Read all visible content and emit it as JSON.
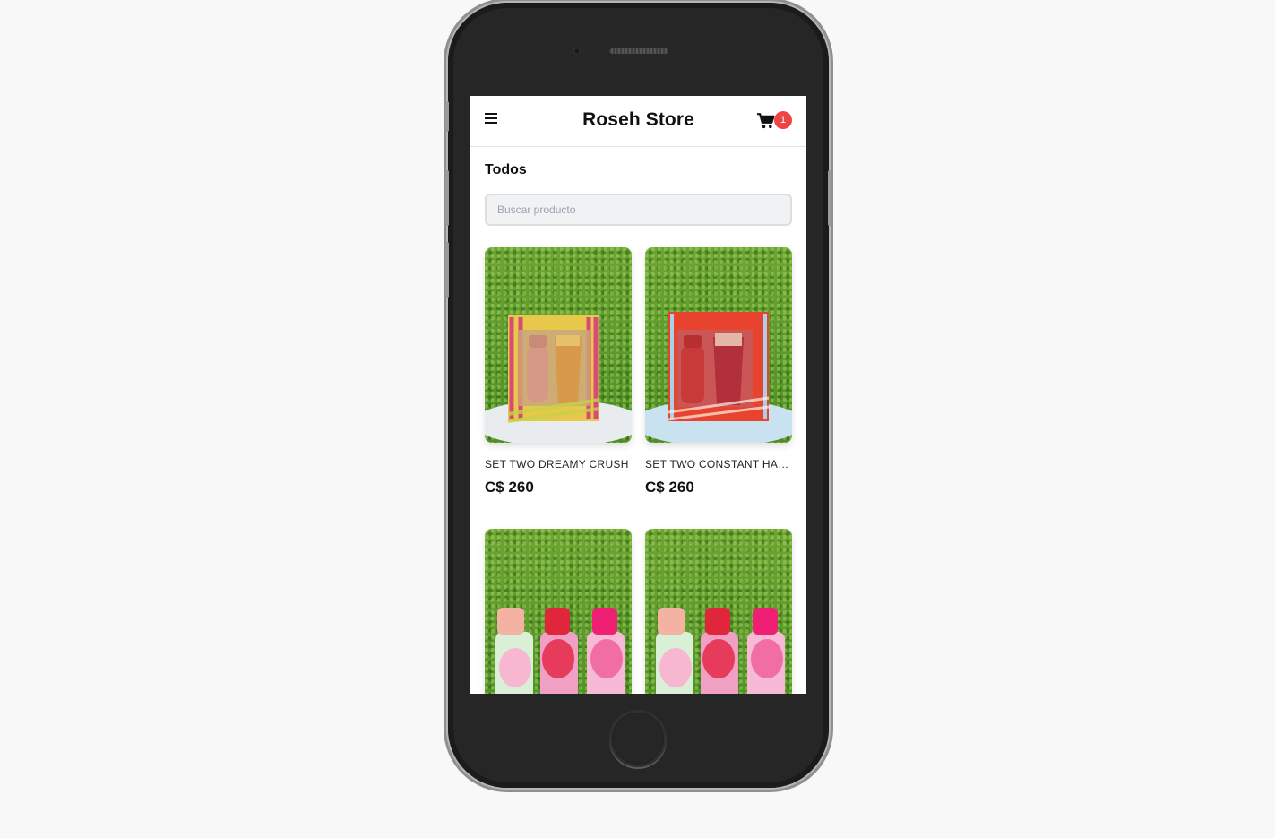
{
  "header": {
    "title": "Roseh Store",
    "cart_count": "1"
  },
  "section": {
    "title": "Todos"
  },
  "search": {
    "placeholder": "Buscar producto",
    "value": ""
  },
  "products": [
    {
      "name": "SET TWO DREAMY CRUSH",
      "price": "C$ 260",
      "image": "gift-set-yellow"
    },
    {
      "name": "SET TWO CONSTANT HAPPINESS",
      "price": "C$ 260",
      "image": "gift-set-red"
    },
    {
      "name": "",
      "price": "",
      "image": "mist-trio"
    },
    {
      "name": "",
      "price": "",
      "image": "mist-trio"
    }
  ],
  "icons": {
    "menu": "hamburger-icon",
    "cart": "shopping-cart-icon"
  },
  "colors": {
    "badge": "#ef4444",
    "accent": "#111111"
  }
}
